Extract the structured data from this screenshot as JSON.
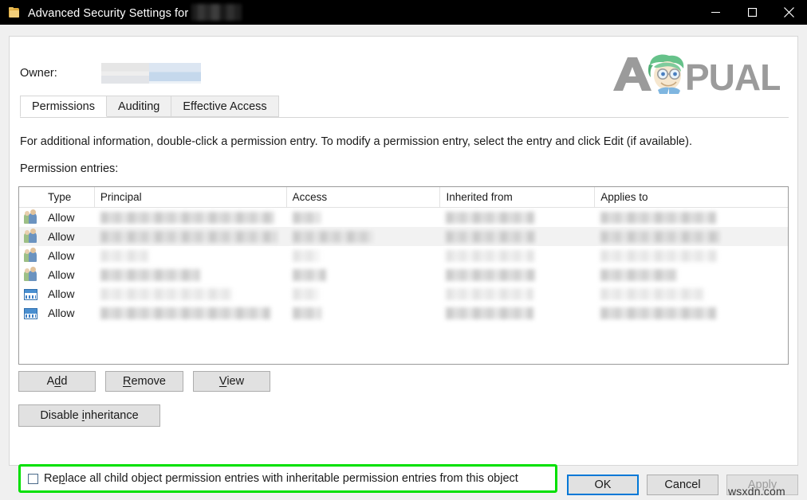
{
  "window": {
    "title": "Advanced Security Settings for",
    "title_redacted_suffix": "",
    "icon": "folder-icon",
    "minimize_label": "Minimize",
    "maximize_label": "Maximize",
    "close_label": "Close"
  },
  "owner": {
    "label": "Owner:",
    "value": ""
  },
  "logo": {
    "text_a": "A",
    "text_rest": "PUALS",
    "color_text": "#9b9b9b",
    "color_hair": "#66c28a",
    "color_skin": "#f3e2c8"
  },
  "tabs": [
    {
      "label": "Permissions",
      "active": true
    },
    {
      "label": "Auditing",
      "active": false
    },
    {
      "label": "Effective Access",
      "active": false
    }
  ],
  "info_text": "For additional information, double-click a permission entry. To modify a permission entry, select the entry and click Edit (if available).",
  "entries_label": "Permission entries:",
  "table": {
    "columns": [
      "",
      "Type",
      "Principal",
      "Access",
      "Inherited from",
      "Applies to"
    ],
    "rows": [
      {
        "icon": "group-icon",
        "type": "Allow",
        "principal": "",
        "access": "",
        "inherited_from": "",
        "applies_to": "",
        "selected": false
      },
      {
        "icon": "group-icon",
        "type": "Allow",
        "principal": "",
        "access": "",
        "inherited_from": "",
        "applies_to": "",
        "selected": true
      },
      {
        "icon": "group-icon",
        "type": "Allow",
        "principal": "",
        "access": "",
        "inherited_from": "",
        "applies_to": "",
        "selected": false
      },
      {
        "icon": "group-icon",
        "type": "Allow",
        "principal": "",
        "access": "",
        "inherited_from": "",
        "applies_to": "",
        "selected": false
      },
      {
        "icon": "window-icon",
        "type": "Allow",
        "principal": "",
        "access": "",
        "inherited_from": "",
        "applies_to": "",
        "selected": false
      },
      {
        "icon": "window-icon",
        "type": "Allow",
        "principal": "",
        "access": "",
        "inherited_from": "",
        "applies_to": "",
        "selected": false
      }
    ]
  },
  "buttons": {
    "add": "Add",
    "remove": "Remove",
    "view": "View",
    "disable_inheritance": "Disable inheritance",
    "ok": "OK",
    "cancel": "Cancel",
    "apply": "Apply"
  },
  "checkbox": {
    "label": "Replace all child object permission entries with inheritable permission entries from this object",
    "checked": false,
    "highlight_color": "#00e000"
  },
  "watermark": "wsxdn.com"
}
